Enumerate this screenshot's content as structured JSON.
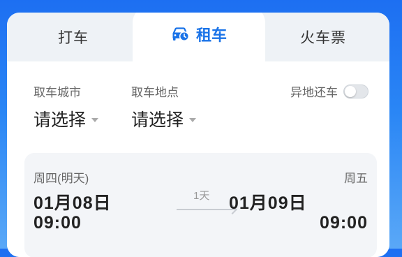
{
  "tabs": {
    "left_label": "打车",
    "active_label": "租车",
    "right_label": "火车票",
    "active_icon": "car-clock-icon",
    "accent": "#1a73e8"
  },
  "pickup": {
    "city_label": "取车城市",
    "city_value": "请选择",
    "place_label": "取车地点",
    "place_value": "请选择"
  },
  "return_elsewhere": {
    "label": "异地还车",
    "enabled": false
  },
  "dates": {
    "start_weekday": "周四(明天)",
    "start_date": "01月08日",
    "start_time": "09:00",
    "duration": "1天",
    "end_weekday": "周五",
    "end_date": "01月09日",
    "end_time": "09:00"
  }
}
